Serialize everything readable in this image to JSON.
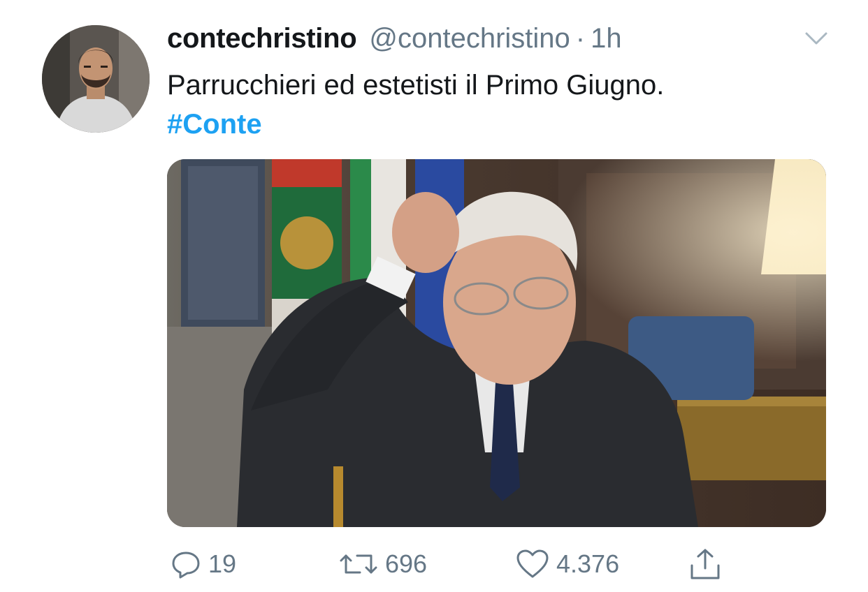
{
  "tweet": {
    "display_name": "contechristino",
    "handle": "@contechristino",
    "separator": "·",
    "time": "1h",
    "text": "Parrucchieri ed estetisti il Primo Giugno.",
    "hashtag": "#Conte"
  },
  "actions": {
    "replies": "19",
    "retweets": "696",
    "likes": "4.376"
  },
  "icons": {
    "reply": "reply-icon",
    "retweet": "retweet-icon",
    "like": "heart-icon",
    "share": "share-icon",
    "menu": "chevron-down-icon"
  },
  "colors": {
    "text": "#14171a",
    "secondary": "#657786",
    "link": "#1da1f2"
  }
}
